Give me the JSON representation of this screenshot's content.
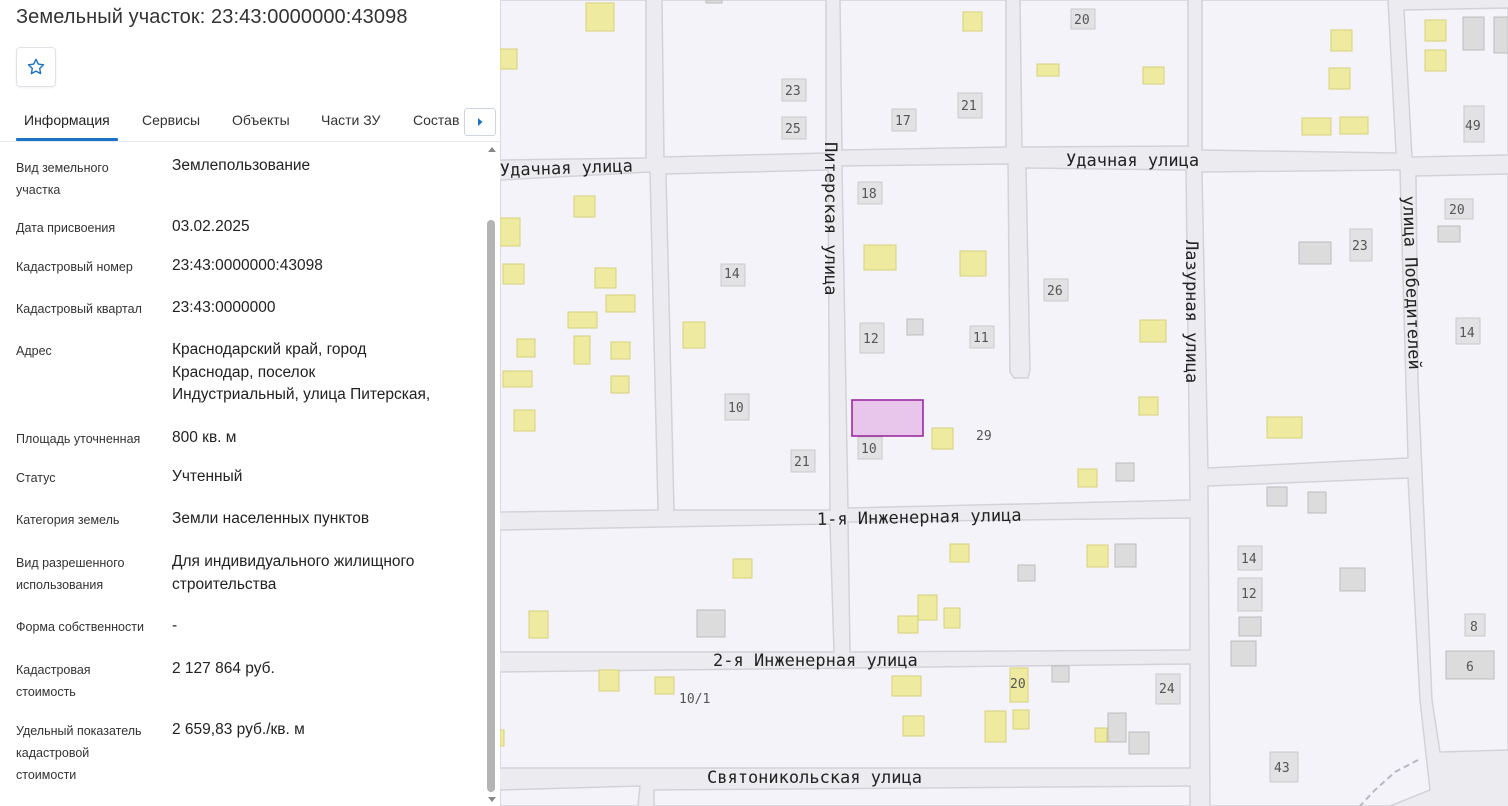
{
  "panel": {
    "title": "Земельный участок: 23:43:0000000:43098",
    "favorite_icon": "star-outline-icon",
    "tabs": [
      {
        "label": "Информация",
        "active": true
      },
      {
        "label": "Сервисы",
        "active": false
      },
      {
        "label": "Объекты",
        "active": false
      },
      {
        "label": "Части ЗУ",
        "active": false
      },
      {
        "label": "Состав",
        "active": false
      }
    ],
    "tabs_next_icon": "chevron-right-icon",
    "rows": [
      {
        "label_lines": [
          "Вид земельного",
          "участка"
        ],
        "value_lines": [
          "Землепользование"
        ]
      },
      {
        "label_lines": [
          "Дата присвоения"
        ],
        "value_lines": [
          "03.02.2025"
        ]
      },
      {
        "label_lines": [
          "Кадастровый номер"
        ],
        "value_lines": [
          "23:43:0000000:43098"
        ]
      },
      {
        "label_lines": [
          "Кадастровый квартал"
        ],
        "value_lines": [
          "23:43:0000000"
        ]
      },
      {
        "label_lines": [
          "Адрес"
        ],
        "value_lines": [
          "Краснодарский край, город",
          "Краснодар, поселок",
          "Индустриальный, улица Питерская,"
        ]
      },
      {
        "label_lines": [
          "Площадь уточненная"
        ],
        "value_lines": [
          "800 кв. м"
        ]
      },
      {
        "label_lines": [
          "Статус"
        ],
        "value_lines": [
          "Учтенный"
        ]
      },
      {
        "label_lines": [
          "Категория земель"
        ],
        "value_lines": [
          "Земли населенных пунктов"
        ]
      },
      {
        "label_lines": [
          "Вид разрешенного",
          "использования"
        ],
        "value_lines": [
          "Для индивидуального жилищного",
          "строительства"
        ]
      },
      {
        "label_lines": [
          "Форма собственности"
        ],
        "value_lines": [
          "-"
        ]
      },
      {
        "label_lines": [
          "Кадастровая",
          "стоимость"
        ],
        "value_lines": [
          "2 127 864 руб."
        ]
      },
      {
        "label_lines": [
          "Удельный показатель",
          "кадастровой",
          "стоимости"
        ],
        "value_lines": [
          "2 659,83 руб./кв. м"
        ]
      }
    ]
  },
  "map": {
    "colors": {
      "background": "#ececf0",
      "block": "#f4f3f9",
      "road": "#ffffff",
      "road_edge": "#d2d2d8",
      "building": "#eeeaa0",
      "building_stroke": "#d6d27a",
      "building_gray": "#dcdcdc",
      "parcel_fill": "#e8c6ec",
      "parcel_stroke": "#9a2aa0",
      "accent": "#1a73c9"
    },
    "streets": [
      {
        "name": "Удачная улица"
      },
      {
        "name": "Удачная улица"
      },
      {
        "name": "Питерская улица"
      },
      {
        "name": "Лазурная улица"
      },
      {
        "name": "улица Победителей"
      },
      {
        "name": "1-я Инженерная улица"
      },
      {
        "name": "2-я Инженерная улица"
      },
      {
        "name": "Святоникольская улица"
      }
    ],
    "house_numbers": [
      "20",
      "23",
      "21",
      "25",
      "17",
      "49",
      "18",
      "20",
      "23",
      "14",
      "26",
      "12",
      "11",
      "14",
      "10",
      "29",
      "10",
      "21",
      "14",
      "12",
      "8",
      "6",
      "10/1",
      "20",
      "24",
      "43"
    ]
  }
}
